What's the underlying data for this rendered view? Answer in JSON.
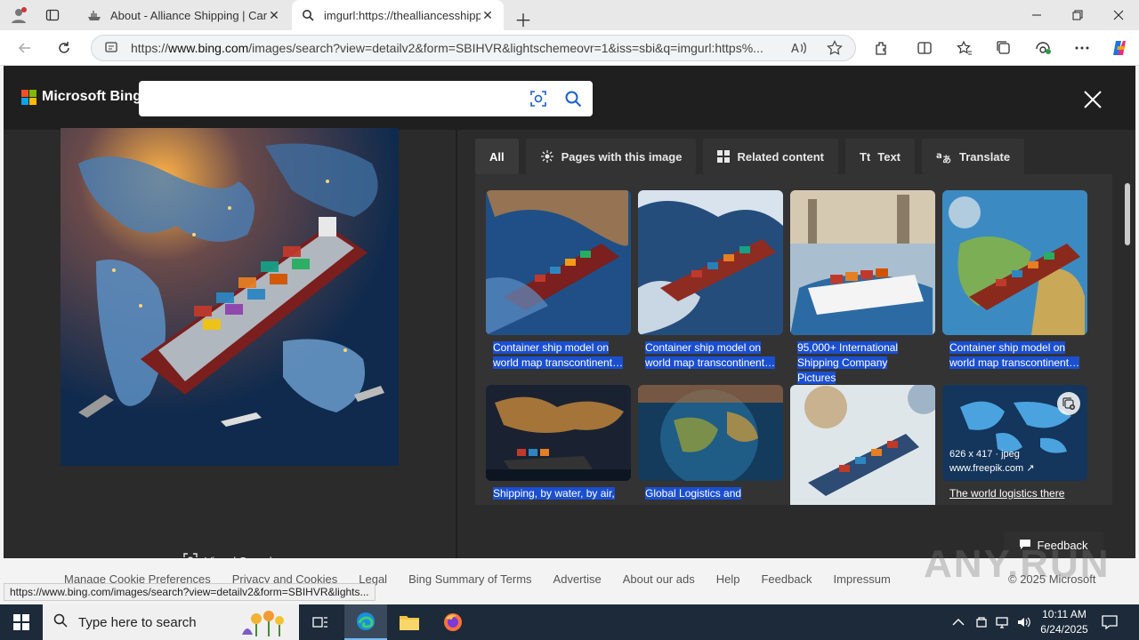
{
  "browser": {
    "tabs": [
      {
        "label": "About - Alliance Shipping | Cargo",
        "active": false
      },
      {
        "label": "imgurl:https://thealliancesshipping",
        "active": true
      }
    ],
    "url_prefix": "https://",
    "url_domain": "www.bing.com",
    "url_rest": "/images/search?view=detailv2&form=SBIHVR&lightschemeovr=1&iss=sbi&q=imgurl:https%...",
    "status_url": "https://www.bing.com/images/search?view=detailv2&form=SBIHVR&lights..."
  },
  "bing": {
    "brand": "Microsoft Bing",
    "search_value": "",
    "visual_search_label": "Visual Search",
    "tabs": [
      {
        "label": "All",
        "icon": "none",
        "selected": true
      },
      {
        "label": "Pages with this image",
        "icon": "pages-icon",
        "selected": false
      },
      {
        "label": "Related content",
        "icon": "grid-icon",
        "selected": false
      },
      {
        "label": "Text",
        "icon": "text-icon",
        "selected": false
      },
      {
        "label": "Translate",
        "icon": "translate-icon",
        "selected": false
      }
    ],
    "results": [
      {
        "caption": "Container ship model on world map transcontinent…"
      },
      {
        "caption": "Container ship model on world map transcontinent…"
      },
      {
        "caption": "95,000+ International Shipping Company Pictures"
      },
      {
        "caption": "Container ship model on world map transcontinent…"
      },
      {
        "caption": "Shipping, by water, by air,"
      },
      {
        "caption": "Global Logistics and"
      },
      {
        "caption": ""
      },
      {
        "caption": "The world logistics there",
        "meta_size": "626 x 417 · jpeg",
        "meta_site": "www.freepik.com"
      }
    ],
    "feedback_label": "Feedback"
  },
  "footer": {
    "links": [
      "Manage Cookie Preferences",
      "Privacy and Cookies",
      "Legal",
      "Bing Summary of Terms",
      "Advertise",
      "About our ads",
      "Help",
      "Feedback",
      "Impressum"
    ],
    "copyright": "© 2025 Microsoft"
  },
  "watermark": "ANY.RUN",
  "taskbar": {
    "search_placeholder": "Type here to search",
    "time": "10:11 AM",
    "date": "6/24/2025"
  }
}
